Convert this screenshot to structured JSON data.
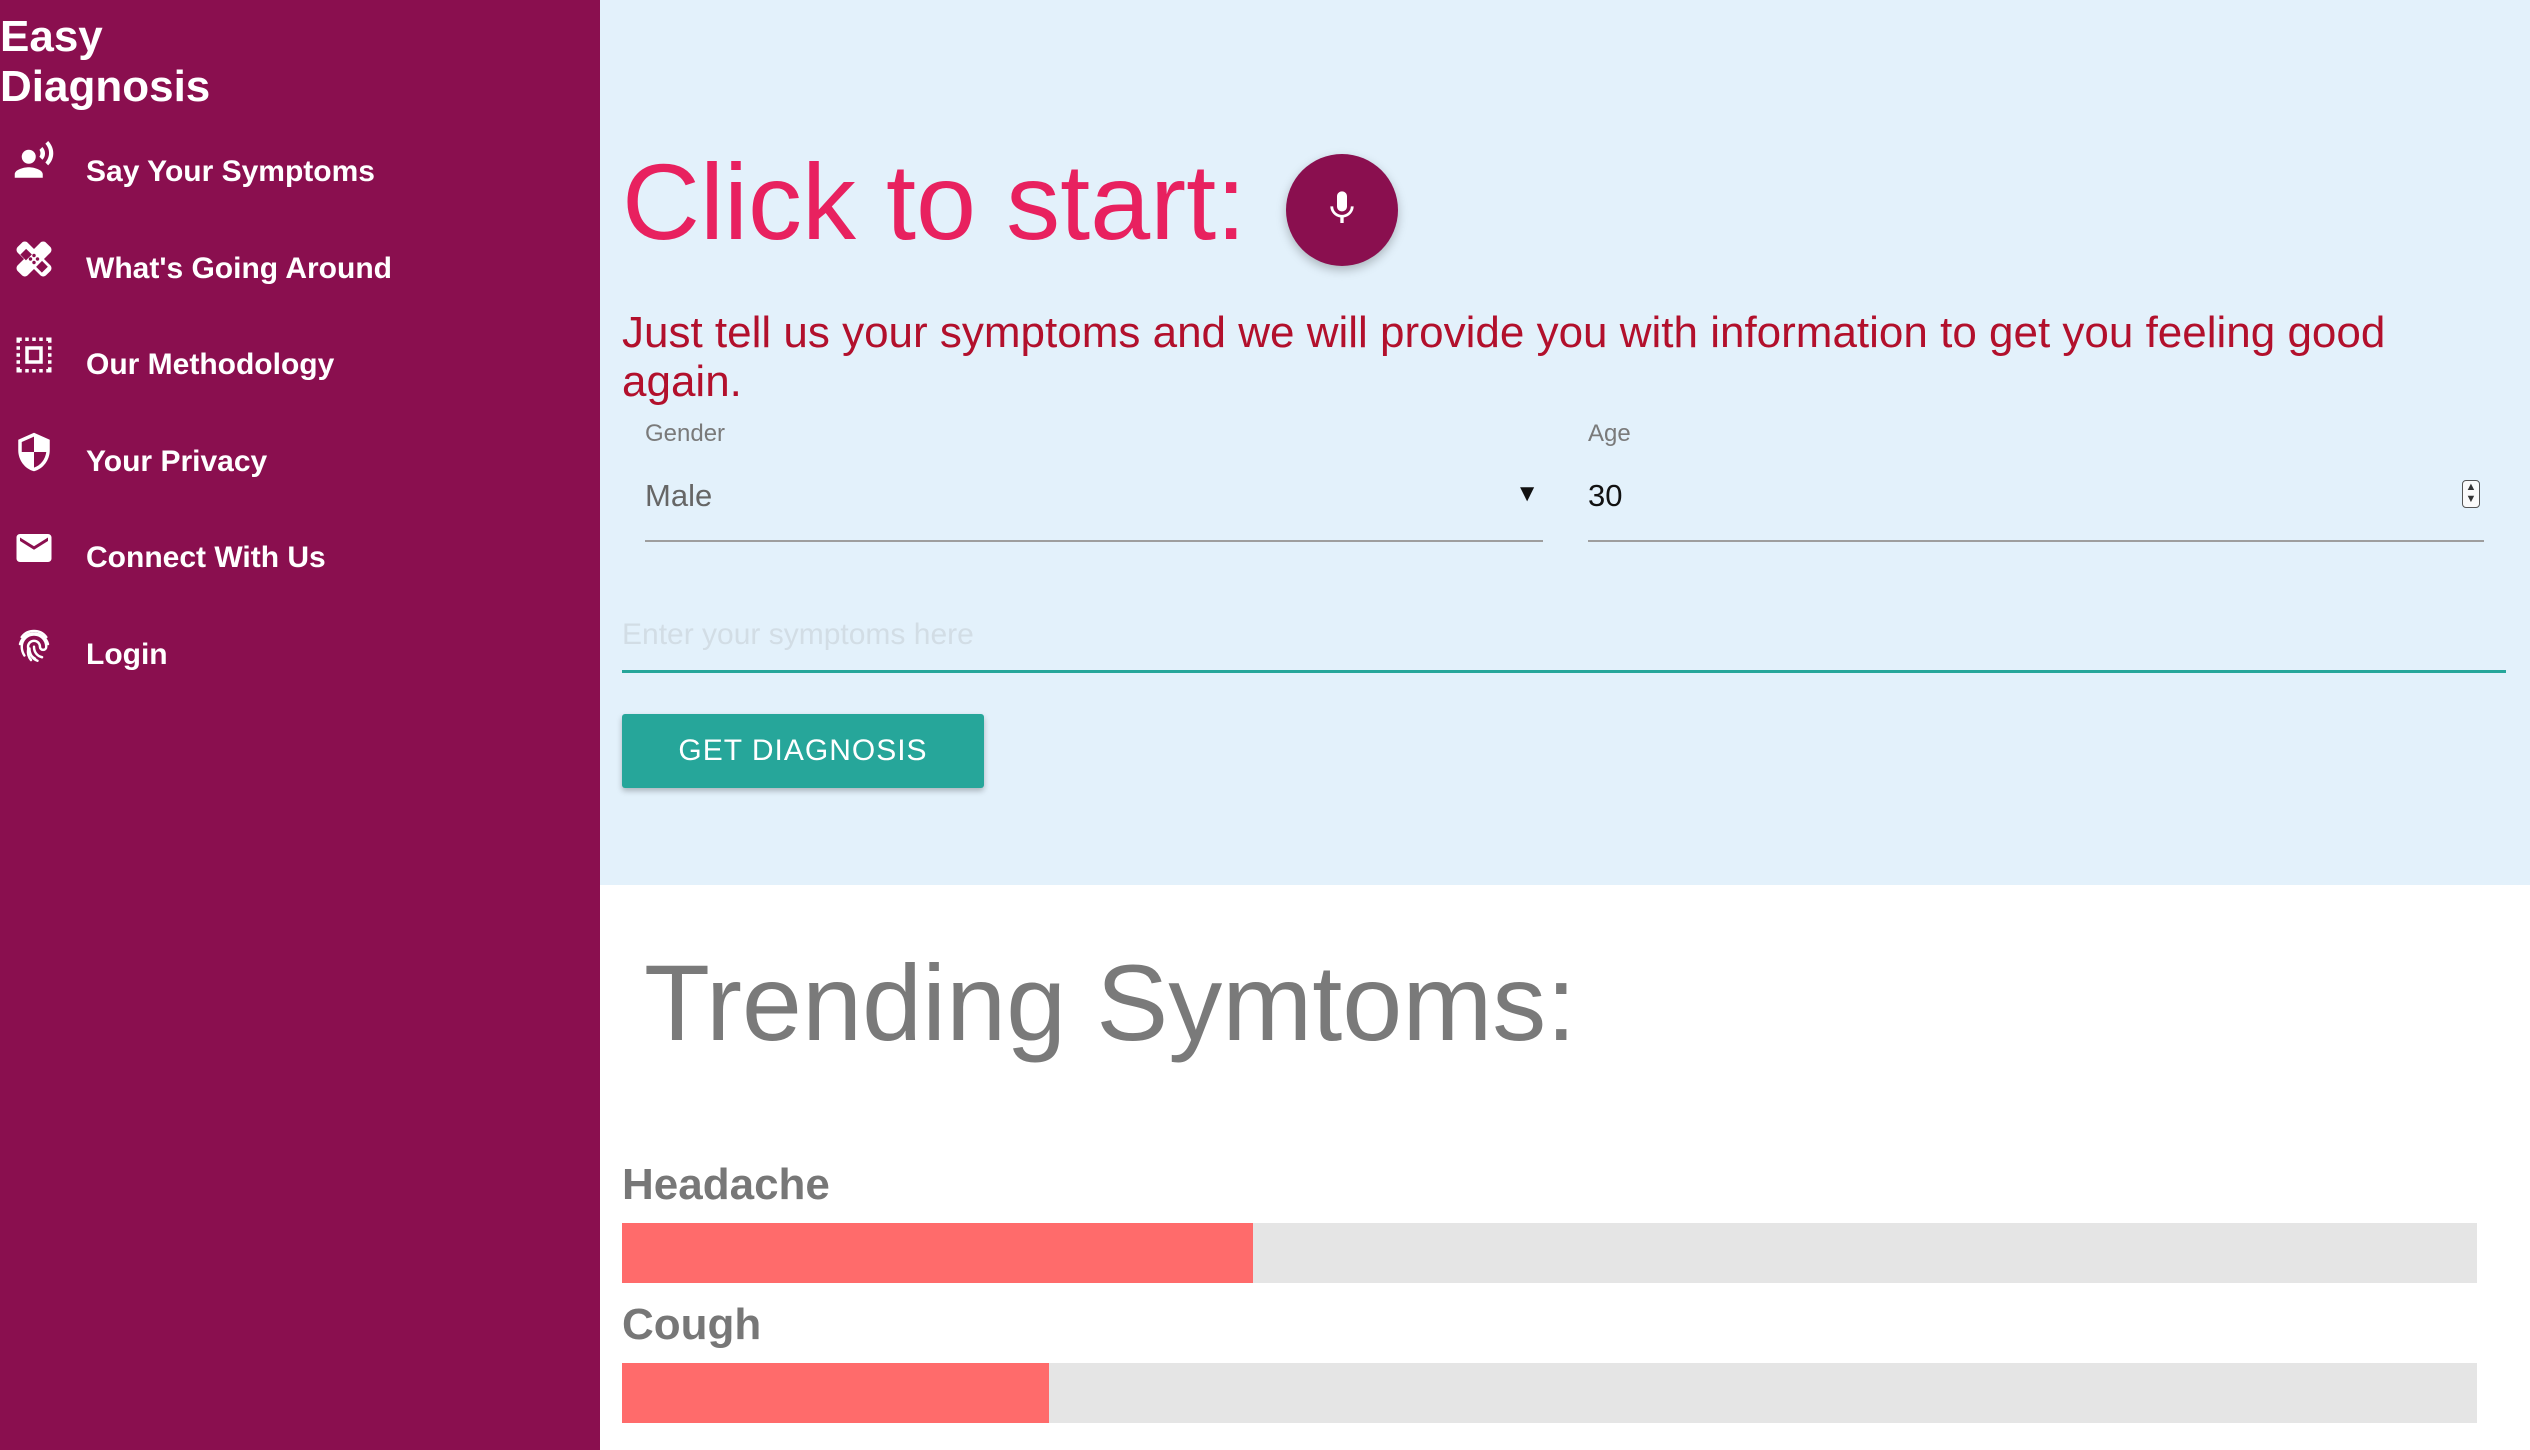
{
  "sidebar": {
    "brand": "Easy Diagnosis",
    "items": [
      {
        "label": "Say Your Symptoms",
        "icon": "record-voice-icon"
      },
      {
        "label": "What's Going Around",
        "icon": "bandage-icon"
      },
      {
        "label": "Our Methodology",
        "icon": "chip-icon"
      },
      {
        "label": "Your Privacy",
        "icon": "shield-icon"
      },
      {
        "label": "Connect With Us",
        "icon": "mail-icon"
      },
      {
        "label": "Login",
        "icon": "fingerprint-icon"
      }
    ]
  },
  "hero": {
    "title": "Click to start:",
    "mic_icon": "mic-icon",
    "intro": "Just tell us your symptoms and we will provide you with information to get you feeling good again."
  },
  "form": {
    "gender_label": "Gender",
    "gender_value": "Male",
    "age_label": "Age",
    "age_value": "30",
    "symptoms_placeholder": "Enter your symptoms here",
    "submit_label": "GET DIAGNOSIS"
  },
  "trending": {
    "title": "Trending Symtoms:",
    "items": [
      {
        "name": "Headache",
        "percent": 34
      },
      {
        "name": "Cough",
        "percent": 23
      }
    ]
  },
  "colors": {
    "sidebar_bg": "#8a0f4f",
    "hero_bg": "#e3f1fb",
    "accent_pink": "#e8215f",
    "intro_red": "#b2102c",
    "teal": "#26a69a",
    "bar_fill": "#ff6b6b",
    "bar_track": "#e5e5e5"
  }
}
